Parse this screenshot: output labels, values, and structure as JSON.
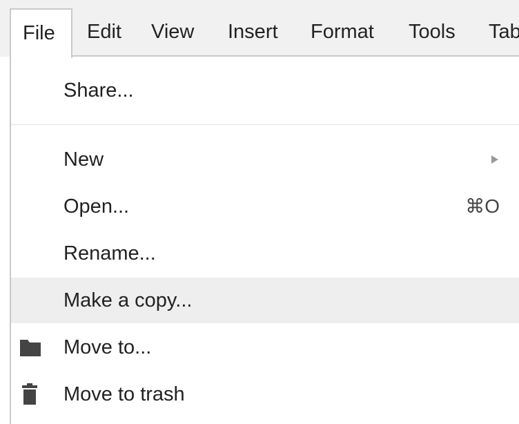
{
  "menubar": {
    "items": [
      {
        "label": "File",
        "active": true
      },
      {
        "label": "Edit"
      },
      {
        "label": "View"
      },
      {
        "label": "Insert"
      },
      {
        "label": "Format"
      },
      {
        "label": "Tools"
      },
      {
        "label": "Tab"
      }
    ]
  },
  "file_menu": {
    "share": {
      "label": "Share..."
    },
    "new": {
      "label": "New",
      "icon": "submenu-arrow-icon"
    },
    "open": {
      "label": "Open...",
      "shortcut": "⌘O"
    },
    "rename": {
      "label": "Rename..."
    },
    "make_copy": {
      "label": "Make a copy...",
      "highlighted": true
    },
    "move_to": {
      "label": "Move to...",
      "icon": "folder-icon"
    },
    "move_to_trash": {
      "label": "Move to trash",
      "icon": "trash-icon"
    }
  },
  "colors": {
    "menubar_bg": "#f1f1f1",
    "menu_bg": "#ffffff",
    "highlight_bg": "#eeeeee",
    "text": "#222222",
    "icon": "#444444",
    "border": "#c9c9c9"
  }
}
